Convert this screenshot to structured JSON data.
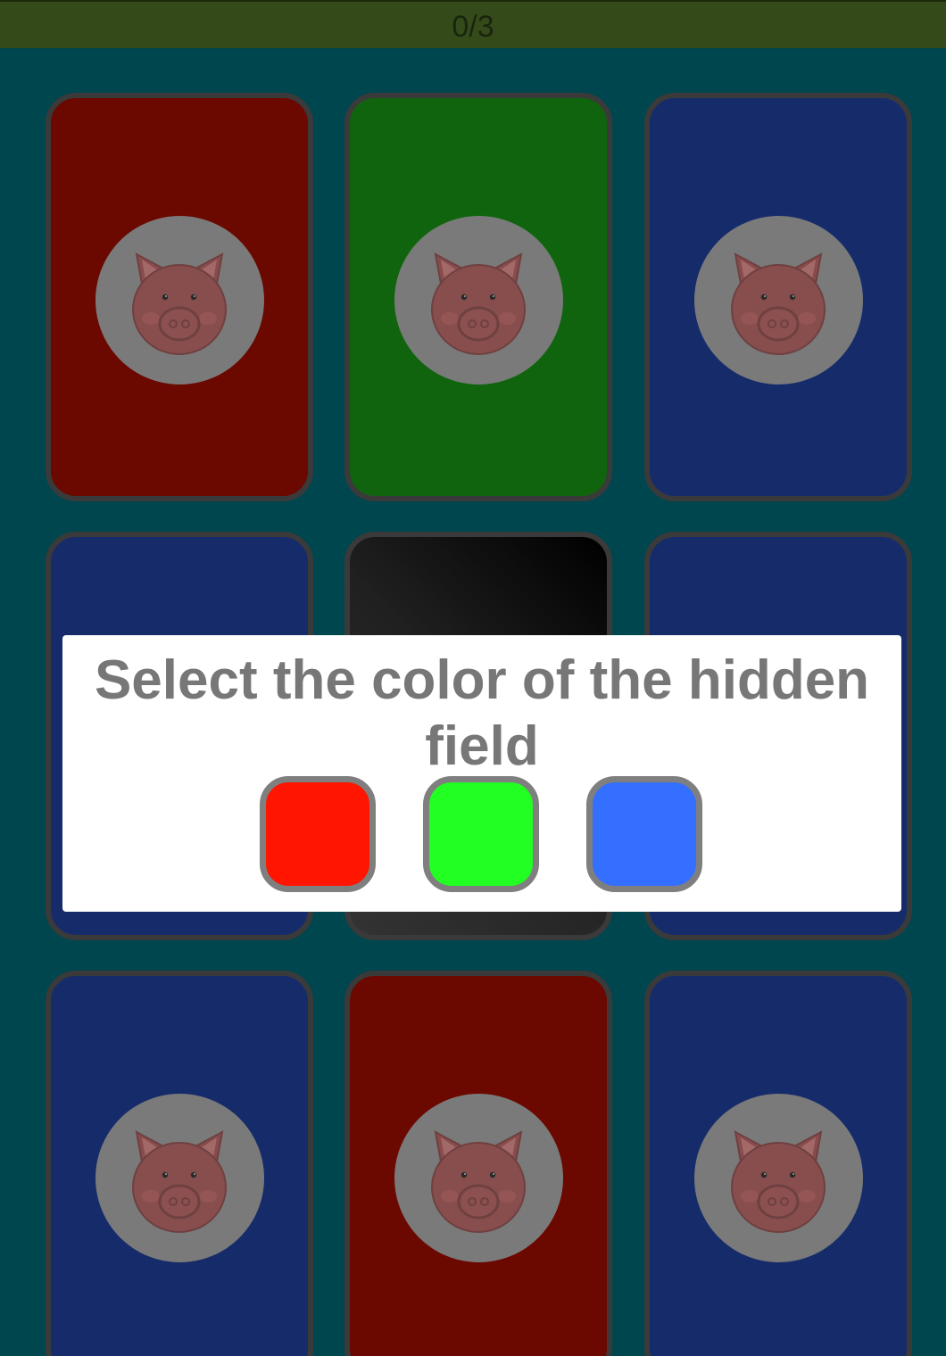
{
  "header": {
    "score": "0/3"
  },
  "prompt": "Select the color of the hidden field",
  "cards": [
    {
      "color": "#6b0800",
      "icon": "pig-icon"
    },
    {
      "color": "#10640e",
      "icon": "pig-icon"
    },
    {
      "color": "#162c6a",
      "icon": "pig-icon"
    },
    {
      "color": "#162c6a",
      "icon": "pig-icon"
    },
    {
      "color": "hidden",
      "icon": ""
    },
    {
      "color": "#162c6a",
      "icon": "pig-icon"
    },
    {
      "color": "#162c6a",
      "icon": "pig-icon"
    },
    {
      "color": "#6b0800",
      "icon": "pig-icon"
    },
    {
      "color": "#162c6a",
      "icon": "pig-icon"
    }
  ],
  "choices": [
    {
      "name": "red",
      "color": "#ff1500"
    },
    {
      "name": "green",
      "color": "#22ff22"
    },
    {
      "name": "blue",
      "color": "#346fff"
    }
  ]
}
